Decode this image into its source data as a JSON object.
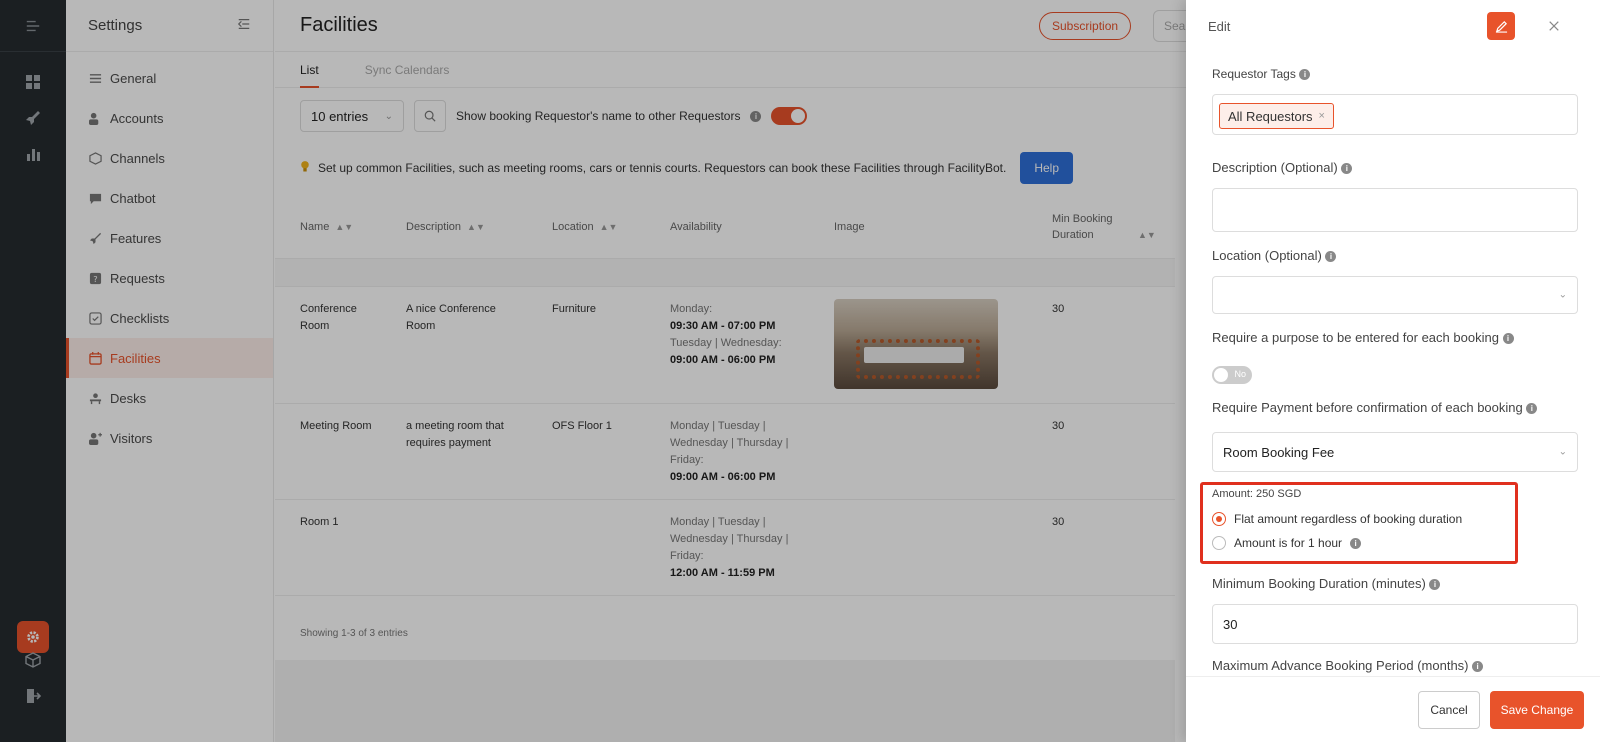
{
  "sidebar": {
    "title": "Settings",
    "items": [
      {
        "label": "General",
        "icon": "sliders-icon"
      },
      {
        "label": "Accounts",
        "icon": "users-icon"
      },
      {
        "label": "Channels",
        "icon": "cube-icon"
      },
      {
        "label": "Chatbot",
        "icon": "chat-icon"
      },
      {
        "label": "Features",
        "icon": "rocket-icon"
      },
      {
        "label": "Requests",
        "icon": "question-icon"
      },
      {
        "label": "Checklists",
        "icon": "checklist-icon"
      },
      {
        "label": "Facilities",
        "icon": "calendar-icon"
      },
      {
        "label": "Desks",
        "icon": "desk-icon"
      },
      {
        "label": "Visitors",
        "icon": "visitor-icon"
      }
    ]
  },
  "header": {
    "title": "Facilities",
    "subscription_label": "Subscription",
    "search_placeholder": "Search"
  },
  "tabs": [
    "List",
    "Sync Calendars"
  ],
  "controls": {
    "entries": "10 entries",
    "show_name_label": "Show booking Requestor's name to other Requestors"
  },
  "tip": {
    "text": "Set up common Facilities, such as meeting rooms, cars or tennis courts. Requestors can book these Facilities through FacilityBot.",
    "help_label": "Help"
  },
  "table": {
    "headers": [
      "Name",
      "Description",
      "Location",
      "Availability",
      "Image",
      "Min Booking Duration"
    ],
    "rows": [
      {
        "name": "Conference Room",
        "description": "A nice Conference Room",
        "location": "Furniture",
        "avail_1": "Monday:",
        "avail_2": "09:30 AM - 07:00 PM",
        "avail_3": "Tuesday | Wednesday:",
        "avail_4": "09:00 AM - 06:00 PM",
        "min": "30"
      },
      {
        "name": "Meeting Room",
        "description": "a meeting room that requires payment",
        "location": "OFS Floor 1",
        "avail_1": "Monday | Tuesday |",
        "avail_2": "Wednesday | Thursday |",
        "avail_3": "Friday:",
        "avail_4": "09:00 AM - 06:00 PM",
        "min": "30"
      },
      {
        "name": "Room 1",
        "description": "",
        "location": "",
        "avail_1": "Monday | Tuesday |",
        "avail_2": "Wednesday | Thursday |",
        "avail_3": "Friday:",
        "avail_4": "12:00 AM - 11:59 PM",
        "min": "30"
      }
    ],
    "showing": "Showing 1-3 of 3 entries"
  },
  "panel": {
    "title": "Edit",
    "requestor_tags_label": "Requestor Tags",
    "requestor_tag_chip": "All Requestors",
    "description_label": "Description (Optional)",
    "location_label": "Location (Optional)",
    "purpose_label": "Require a purpose to be entered for each booking",
    "purpose_toggle": "No",
    "payment_label": "Require Payment before confirmation of each booking",
    "payment_value": "Room Booking Fee",
    "amount_label": "Amount: 250 SGD",
    "radio_flat": "Flat amount regardless of booking duration",
    "radio_hourly": "Amount is for 1 hour",
    "min_duration_label": "Minimum Booking Duration (minutes)",
    "min_duration_value": "30",
    "max_advance_label": "Maximum Advance Booking Period (months)",
    "cancel_label": "Cancel",
    "save_label": "Save Change"
  },
  "colors": {
    "accent": "#e8532b",
    "highlight": "#e0301e",
    "help_button": "#2f6fd8",
    "rail": "#262b30"
  }
}
